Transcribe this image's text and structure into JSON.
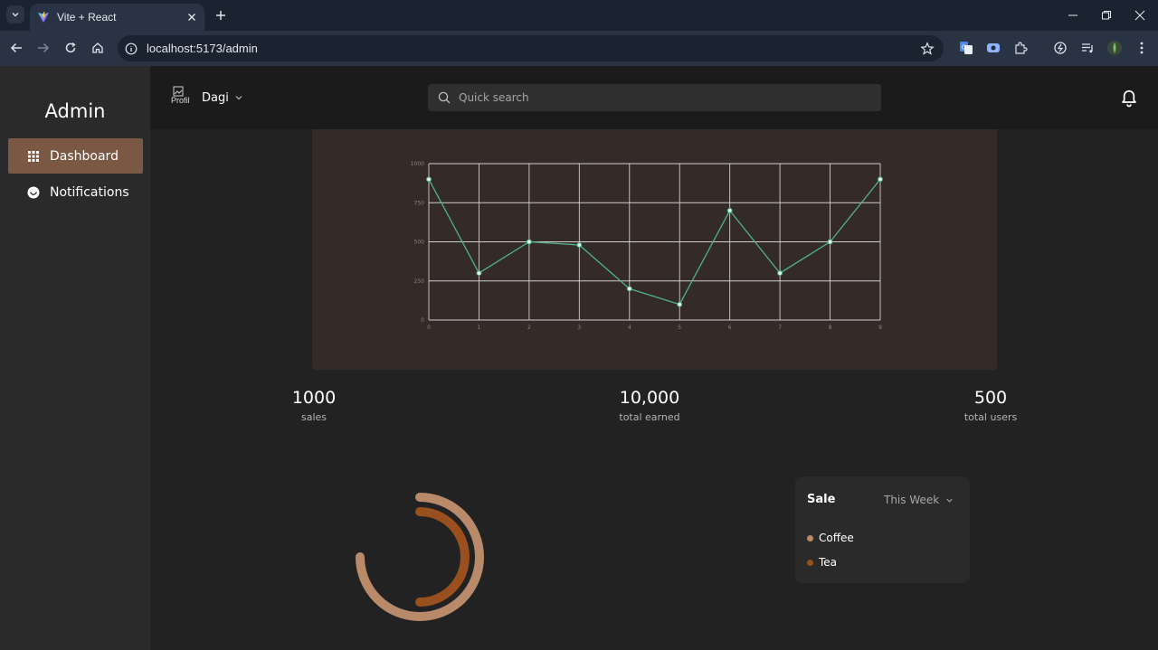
{
  "browser": {
    "tab_title": "Vite + React",
    "url": "localhost:5173/admin"
  },
  "sidebar": {
    "brand": "Admin",
    "items": [
      {
        "label": "Dashboard",
        "icon": "grid-icon",
        "active": true
      },
      {
        "label": "Notifications",
        "icon": "notification-icon",
        "active": false
      }
    ]
  },
  "topbar": {
    "avatar_alt": "Profil",
    "user_name": "Dagi",
    "search_placeholder": "Quick search"
  },
  "colors": {
    "accent_active": "#7a5844",
    "line": "#4fb387",
    "donut_outer": "#b88a6a",
    "donut_inner": "#9a4f1e",
    "coffee": "#b88a6a",
    "tea": "#9a4f1e"
  },
  "chart_data": {
    "type": "line",
    "x": [
      0,
      1,
      2,
      3,
      4,
      5,
      6,
      7,
      8,
      9
    ],
    "y": [
      900,
      300,
      500,
      480,
      200,
      100,
      700,
      300,
      500,
      900
    ],
    "ylim": [
      0,
      1000
    ],
    "yticks": [
      0,
      250,
      500,
      750,
      1000
    ],
    "xticks": [
      "0",
      "1",
      "2",
      "3",
      "4",
      "5",
      "6",
      "7",
      "8",
      "9"
    ],
    "grid": true,
    "title": "",
    "xlabel": "",
    "ylabel": ""
  },
  "stats": [
    {
      "value": "1000",
      "label": "sales"
    },
    {
      "value": "10,000",
      "label": "total earned"
    },
    {
      "value": "500",
      "label": "total users"
    }
  ],
  "donut": {
    "series": [
      {
        "name": "Coffee",
        "fraction": 0.75
      },
      {
        "name": "Tea",
        "fraction": 0.5
      }
    ]
  },
  "sale_card": {
    "title": "Sale",
    "period": "This Week",
    "legend": [
      "Coffee",
      "Tea"
    ]
  }
}
